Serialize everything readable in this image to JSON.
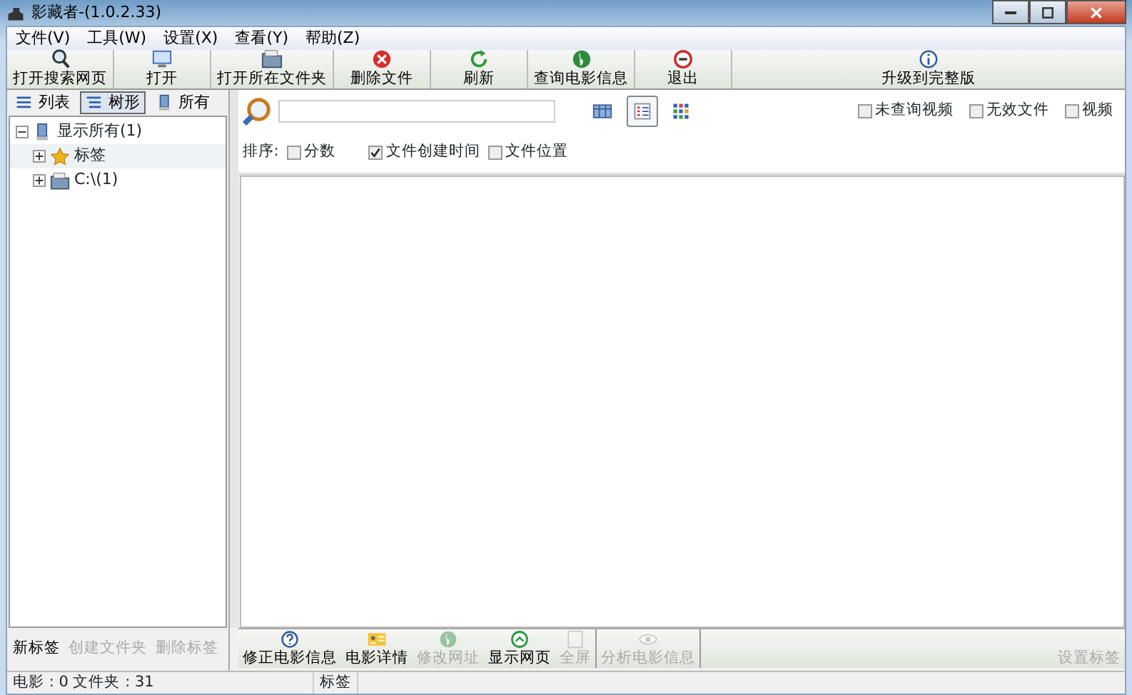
{
  "window": {
    "title": "影藏者-(1.0.2.33)"
  },
  "menu": [
    "文件(V)",
    "工具(W)",
    "设置(X)",
    "查看(Y)",
    "帮助(Z)"
  ],
  "toolbar": [
    {
      "label": "打开搜索网页",
      "kind": "search"
    },
    {
      "label": "打开",
      "kind": "monitor"
    },
    {
      "label": "打开所在文件夹",
      "kind": "folder"
    },
    {
      "label": "删除文件",
      "kind": "delete"
    },
    {
      "label": "刷新",
      "kind": "refresh"
    },
    {
      "label": "查询电影信息",
      "kind": "globe"
    },
    {
      "label": "退出",
      "kind": "exit"
    },
    {
      "label": "升级到完整版",
      "kind": "info"
    }
  ],
  "side_tabs": [
    {
      "label": "列表",
      "selected": false,
      "kind": "list"
    },
    {
      "label": "树形",
      "selected": true,
      "kind": "tree"
    },
    {
      "label": "所有",
      "selected": false,
      "kind": "computer"
    }
  ],
  "tree": [
    {
      "label": "显示所有(1)",
      "kind": "computer",
      "expanded": true,
      "children": [
        {
          "label": "标签",
          "kind": "star",
          "expanded": false,
          "selected": true
        },
        {
          "label": "C:\\(1)",
          "kind": "folder",
          "expanded": false,
          "selected": false
        }
      ]
    }
  ],
  "view_modes": [
    {
      "selected": false,
      "kind": "table"
    },
    {
      "selected": true,
      "kind": "details"
    },
    {
      "selected": false,
      "kind": "grid"
    }
  ],
  "filters": [
    {
      "label": "未查询视频",
      "checked": false
    },
    {
      "label": "无效文件",
      "checked": false
    },
    {
      "label": "视频",
      "checked": false
    }
  ],
  "sort": {
    "label": "排序:",
    "options": [
      {
        "label": "分数",
        "checked": false
      },
      {
        "label": "文件创建时间",
        "checked": true
      },
      {
        "label": "文件位置",
        "checked": false
      }
    ]
  },
  "tag_buttons": [
    {
      "label": "新标签",
      "disabled": false
    },
    {
      "label": "创建文件夹",
      "disabled": true
    },
    {
      "label": "删除标签",
      "disabled": true
    }
  ],
  "bottom_toolbar": [
    {
      "label": "修正电影信息",
      "kind": "help",
      "disabled": false
    },
    {
      "label": "电影详情",
      "kind": "card",
      "disabled": false
    },
    {
      "label": "修改网址",
      "kind": "globe",
      "disabled": true
    },
    {
      "label": "显示网页",
      "kind": "up",
      "disabled": false
    },
    {
      "label": "全屏",
      "kind": "screen",
      "disabled": true
    },
    {
      "label": "分析电影信息",
      "kind": "eye",
      "disabled": true
    },
    {
      "label": "设置标签",
      "kind": "none",
      "disabled": true
    }
  ],
  "status_bar": [
    "电影 : 0 文件夹 : 31",
    "标签"
  ]
}
